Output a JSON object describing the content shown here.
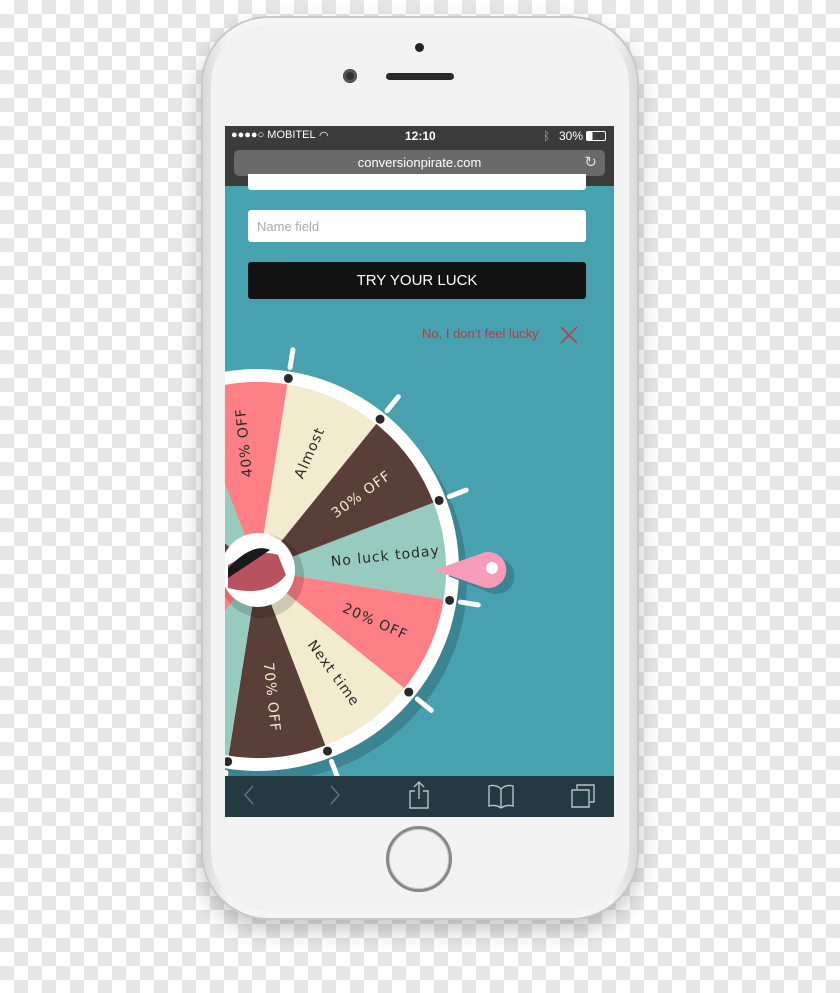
{
  "status_bar": {
    "carrier": "●●●●○ MOBITEL",
    "time": "12:10",
    "battery": "30%",
    "icons": [
      "wifi-icon",
      "bluetooth-icon",
      "battery-icon"
    ]
  },
  "browser": {
    "url": "conversionpirate.com",
    "reload_icon": "reload-icon"
  },
  "form": {
    "name_placeholder": "Name field",
    "submit_label": "TRY YOUR LUCK",
    "decline_label": "No, I don't feel lucky"
  },
  "wheel": {
    "colors": {
      "teal": "#98cbbf",
      "pink": "#fd8086",
      "cream": "#f2ebcd",
      "brown": "#5a3f38",
      "rim": "#ffffff",
      "pointer": "#f79bb9"
    },
    "segments": [
      {
        "label": "No luck today",
        "color": "teal"
      },
      {
        "label": "20% OFF",
        "color": "pink"
      },
      {
        "label": "Next time",
        "color": "cream"
      },
      {
        "label": "70% OFF",
        "color": "brown"
      },
      {
        "label": "",
        "color": "teal"
      },
      {
        "label": "",
        "color": "pink"
      },
      {
        "label": "",
        "color": "cream"
      },
      {
        "label": "",
        "color": "brown"
      },
      {
        "label": "",
        "color": "teal"
      },
      {
        "label": "40% OFF",
        "color": "pink"
      },
      {
        "label": "Almost",
        "color": "cream"
      },
      {
        "label": "30% OFF",
        "color": "brown"
      }
    ]
  },
  "toolbar": {
    "items": [
      "back-icon",
      "forward-icon",
      "share-icon",
      "bookmarks-icon",
      "tabs-icon"
    ]
  },
  "background_color": "#48a1ae"
}
